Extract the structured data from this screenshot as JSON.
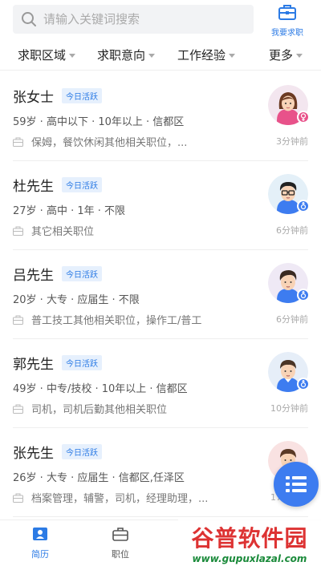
{
  "search": {
    "placeholder": "请输入关键词搜索"
  },
  "header": {
    "post_job_label": "我要求职"
  },
  "filters": [
    {
      "label": "求职区域"
    },
    {
      "label": "求职意向"
    },
    {
      "label": "工作经验"
    },
    {
      "label": "更多"
    }
  ],
  "candidates": [
    {
      "name": "张女士",
      "badge": "今日活跃",
      "meta": "59岁 · 高中以下 · 10年以上 · 信都区",
      "positions": "保姆，餐饮休闲其他相关职位，...",
      "time": "3分钟前",
      "gender": "female",
      "gender_color": "#e8528a"
    },
    {
      "name": "杜先生",
      "badge": "今日活跃",
      "meta": "27岁 · 高中 · 1年 · 不限",
      "positions": "其它相关职位",
      "time": "6分钟前",
      "gender": "male",
      "gender_color": "#3d7cf0"
    },
    {
      "name": "吕先生",
      "badge": "今日活跃",
      "meta": "20岁 · 大专 · 应届生 · 不限",
      "positions": "普工技工其他相关职位，操作工/普工",
      "time": "6分钟前",
      "gender": "male",
      "gender_color": "#3d7cf0"
    },
    {
      "name": "郭先生",
      "badge": "今日活跃",
      "meta": "49岁 · 中专/技校 · 10年以上 · 信都区",
      "positions": "司机，司机后勤其他相关职位",
      "time": "10分钟前",
      "gender": "male",
      "gender_color": "#3d7cf0"
    },
    {
      "name": "张先生",
      "badge": "今日活跃",
      "meta": "26岁 · 大专 · 应届生 · 信都区,任泽区",
      "positions": "档案管理，辅警，司机，经理助理，...",
      "time": "17分钟前",
      "gender": "male",
      "gender_color": "#3d7cf0"
    }
  ],
  "tabs": [
    {
      "label": "简历",
      "active": true
    },
    {
      "label": "职位",
      "active": false
    }
  ],
  "watermark": {
    "title": "谷普软件园",
    "url": "www.gupuxlazal.com"
  },
  "colors": {
    "accent": "#2c7be5",
    "fab": "#3d7cf0",
    "badge_bg": "#e6f0fd",
    "inactive_tab": "#555555"
  }
}
